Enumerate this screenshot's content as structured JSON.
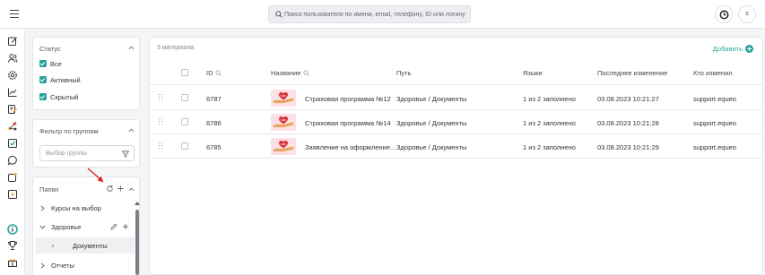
{
  "header": {
    "search_placeholder": "Поиск пользователя по имени, email, телефону, ID или логину",
    "avatar_initial": "s"
  },
  "rail": {
    "icons": [
      "edit-icon",
      "users-icon",
      "settings-icon",
      "chart-icon",
      "document-edit-icon",
      "molecule-icon",
      "checklist-icon",
      "chat-icon",
      "add-note-icon",
      "video-note-icon",
      "info-icon",
      "trophy-icon",
      "gift-icon"
    ]
  },
  "filters": {
    "status": {
      "title": "Статус",
      "options": [
        {
          "label": "Все",
          "checked": true
        },
        {
          "label": "Активный",
          "checked": true
        },
        {
          "label": "Скрытый",
          "checked": true
        }
      ]
    },
    "groups": {
      "title": "Фильтр по группам",
      "placeholder": "Выбор группы"
    },
    "folders": {
      "title": "Папки",
      "items": [
        {
          "label": "Курсы на выбор",
          "expanded": false
        },
        {
          "label": "Здоровье",
          "expanded": true
        },
        {
          "label": "Документы",
          "child": true
        },
        {
          "label": "Отчеты",
          "expanded": false
        }
      ]
    }
  },
  "main": {
    "count_label": "3 материала",
    "add_label": "Добавить",
    "columns": [
      "ID",
      "Название",
      "Путь",
      "Языки",
      "Последнее изменение",
      "Кто изменил"
    ],
    "rows": [
      {
        "id": "6787",
        "name": "Страховая программа №12",
        "path": "Здоровье / Документы",
        "langs": "1 из 2 заполнено",
        "modified": "03.08.2023 10:21:27",
        "by": "support.equeo"
      },
      {
        "id": "6786",
        "name": "Страховая программа №14",
        "path": "Здоровье / Документы",
        "langs": "1 из 2 заполнено",
        "modified": "03.08.2023 10:21:28",
        "by": "support.equeo"
      },
      {
        "id": "6785",
        "name": "Заявление на оформление...",
        "path": "Здоровье / Документы",
        "langs": "1 из 2 заполнено",
        "modified": "03.08.2023 10:21:29",
        "by": "support.equeo"
      }
    ]
  },
  "colors": {
    "accent": "#2aa39a",
    "annotation_arrow": "#e02020"
  }
}
